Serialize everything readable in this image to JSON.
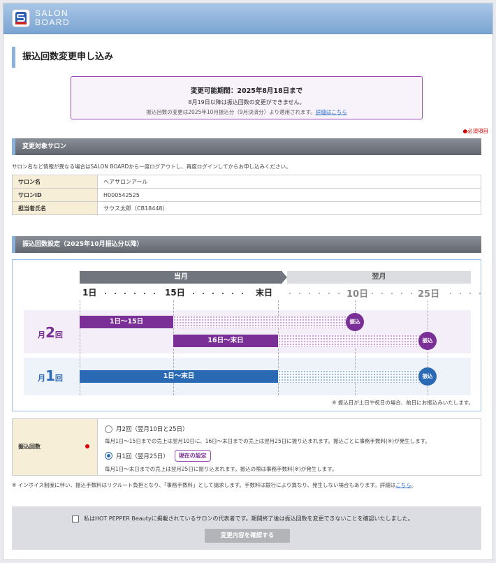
{
  "app": {
    "logo_line1": "SALON",
    "logo_line2": "BOARD"
  },
  "page_title": "振込回数変更申し込み",
  "notice": {
    "title": "変更可能期間：2025年8月18日まで",
    "line2": "8月19日以降は振込回数の変更ができません。",
    "line3": "振込回数の変更は2025年10月振込分（9月決済分）より適用されます。",
    "link": "詳細はこちら"
  },
  "required_label": "●必須項目",
  "section1": {
    "title": "変更対象サロン",
    "desc": "サロン名など情報が異なる場合はSALON BOARDから一度ログアウトし、再度ログインしてからお申し込みください。",
    "rows": [
      {
        "label": "サロン名",
        "value": "ヘアサロンアール"
      },
      {
        "label": "サロンID",
        "value": "H000542525"
      },
      {
        "label": "担当者氏名",
        "value": "サウス太郎（CB18448）"
      }
    ]
  },
  "section2": {
    "title": "振込回数設定（2025年10月振込分以降）",
    "diagram": {
      "current_month": "当月",
      "next_month": "翌月",
      "ticks": {
        "d1": "1日",
        "d15": "15日",
        "end": "末日",
        "n10": "10日",
        "n25": "25日"
      },
      "dots": "・・・・・・",
      "row2": {
        "prefix": "月",
        "num": "2",
        "suffix": "回",
        "bar1": "1日〜15日",
        "bar2": "16日〜末日",
        "pay": "振込"
      },
      "row1": {
        "prefix": "月",
        "num": "1",
        "suffix": "回",
        "bar": "1日〜末日",
        "pay": "振込"
      },
      "note": "※ 振込日が土日や祝日の場合、前日にお振込みいたします。"
    },
    "setting": {
      "label": "振込回数",
      "option1": {
        "label": "月2回（翌月10日と25日）",
        "desc": "毎月1日〜15日までの売上は翌月10日に、16日〜末日までの売上は翌月25日に振り込まれます。振込ごとに事務手数料(※)が発生します。"
      },
      "option2": {
        "label": "月1回（翌月25日）",
        "badge": "現在の設定",
        "desc": "毎月1日〜末日までの売上は翌月25日に振り込まれます。振込の際は事務手数料(※)が発生します。"
      }
    }
  },
  "footnote": {
    "text": "※ インボイス制度に伴い、振込手数料はリクルート負担となり、「事務手数料」として請求します。手数料は銀行により異なり、発生しない場合もあります。詳細は",
    "link": "こちら",
    "end": "。"
  },
  "confirm": {
    "checkbox_label": "私はHOT PEPPER Beautyに掲載されているサロンの代表者です。期間終了後は振込回数を変更できないことを確認いたしました。",
    "button": "変更内容を確認する"
  },
  "colors": {
    "purple": "#7a2f96",
    "blue": "#2a6ab5",
    "header_gray": "#71767e"
  }
}
